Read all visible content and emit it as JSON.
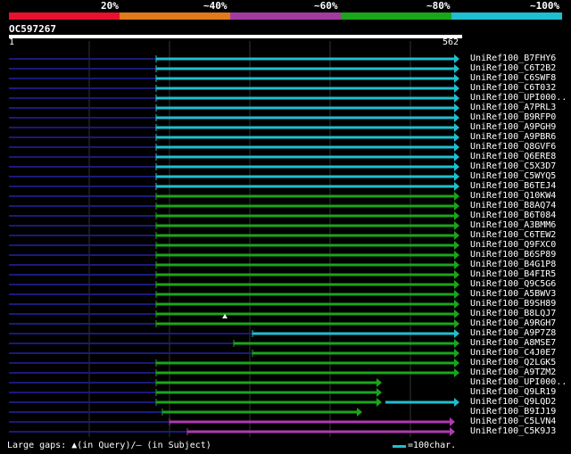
{
  "query": {
    "id": "OC597267",
    "start": "1",
    "end": "562"
  },
  "scale": {
    "labels": [
      "20%",
      "~40%",
      "~60%",
      "~80%",
      "~100%"
    ],
    "colors": [
      "#e8112d",
      "#e07a1a",
      "#a23ba0",
      "#1ba51b",
      "#1fbfcf"
    ]
  },
  "colors": {
    "cyan": "#1fbfcf",
    "green": "#1ba51b",
    "purple": "#b03ab0",
    "gap": "#1a1a7a",
    "grid": "#333333"
  },
  "hits": [
    {
      "label": "UniRef100_B7FHY6",
      "color": "cyan"
    },
    {
      "label": "UniRef100_C6T2B2",
      "color": "cyan"
    },
    {
      "label": "UniRef100_C6SWF8",
      "color": "cyan"
    },
    {
      "label": "UniRef100_C6T032",
      "color": "cyan"
    },
    {
      "label": "UniRef100_UPI000..",
      "color": "cyan"
    },
    {
      "label": "UniRef100_A7PRL3",
      "color": "cyan"
    },
    {
      "label": "UniRef100_B9RFP0",
      "color": "cyan"
    },
    {
      "label": "UniRef100_A9PGH9",
      "color": "cyan"
    },
    {
      "label": "UniRef100_A9PBR6",
      "color": "cyan"
    },
    {
      "label": "UniRef100_Q8GVF6",
      "color": "cyan"
    },
    {
      "label": "UniRef100_Q6ERE8",
      "color": "cyan"
    },
    {
      "label": "UniRef100_C5X3D7",
      "color": "cyan"
    },
    {
      "label": "UniRef100_C5WYQ5",
      "color": "cyan"
    },
    {
      "label": "UniRef100_B6TEJ4",
      "color": "cyan"
    },
    {
      "label": "UniRef100_Q10KW4",
      "color": "green"
    },
    {
      "label": "UniRef100_B8AQ74",
      "color": "green"
    },
    {
      "label": "UniRef100_B6T084",
      "color": "green"
    },
    {
      "label": "UniRef100_A3BMM6",
      "color": "green"
    },
    {
      "label": "UniRef100_C6TEW2",
      "color": "green"
    },
    {
      "label": "UniRef100_Q9FXC0",
      "color": "green"
    },
    {
      "label": "UniRef100_B6SP89",
      "color": "green"
    },
    {
      "label": "UniRef100_B4G1P8",
      "color": "green"
    },
    {
      "label": "UniRef100_B4FIR5",
      "color": "green"
    },
    {
      "label": "UniRef100_Q9C5G6",
      "color": "green"
    },
    {
      "label": "UniRef100_A5BWV3",
      "color": "green"
    },
    {
      "label": "UniRef100_B9SH89",
      "color": "green"
    },
    {
      "label": "UniRef100_B8LQJ7",
      "color": "green"
    },
    {
      "label": "UniRef100_A9RGH7",
      "color": "green"
    },
    {
      "label": "UniRef100_A9P7Z8",
      "color": "cyan"
    },
    {
      "label": "UniRef100_A8MSE7",
      "color": "green"
    },
    {
      "label": "UniRef100_C4J0E7",
      "color": "green"
    },
    {
      "label": "UniRef100_Q2LGK5",
      "color": "green"
    },
    {
      "label": "UniRef100_A9TZM2",
      "color": "green"
    },
    {
      "label": "UniRef100_UPI000..",
      "color": "green"
    },
    {
      "label": "UniRef100_Q9LR19",
      "color": "green"
    },
    {
      "label": "UniRef100_Q9LQD2",
      "color": "green"
    },
    {
      "label": "UniRef100_B9IJ19",
      "color": "green"
    },
    {
      "label": "UniRef100_C5LVN4",
      "color": "purple"
    },
    {
      "label": "UniRef100_C5K9J3",
      "color": "purple"
    }
  ],
  "footer": {
    "gaps_text": "Large gaps: ▲(in Query)/– (in Subject)",
    "legend_text": "=100char."
  }
}
